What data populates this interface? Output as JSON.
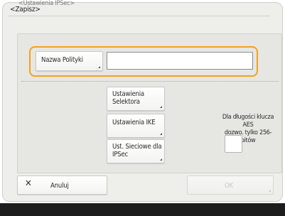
{
  "breadcrumb": {
    "parent": "<Ustawienia IPSec>"
  },
  "dialog": {
    "title": "<Zapisz>"
  },
  "policy": {
    "label": "Nazwa Polityki",
    "value": ""
  },
  "settings": {
    "selector_line1": "Ustawienia",
    "selector_line2": "Selektora",
    "ike_label": "Ustawienia IKE",
    "network_line1": "Ust. Sieciowe dla",
    "network_line2": "IPSec"
  },
  "aes": {
    "note_line1": "Dla długości klucza AES",
    "note_line2": "dozwo. tylko 256-bitów",
    "checked": false
  },
  "footer": {
    "cancel_label": "Anuluj",
    "ok_label": "OK"
  },
  "colors": {
    "highlight": "#f5a11c",
    "panel": "#eeeeeb"
  }
}
